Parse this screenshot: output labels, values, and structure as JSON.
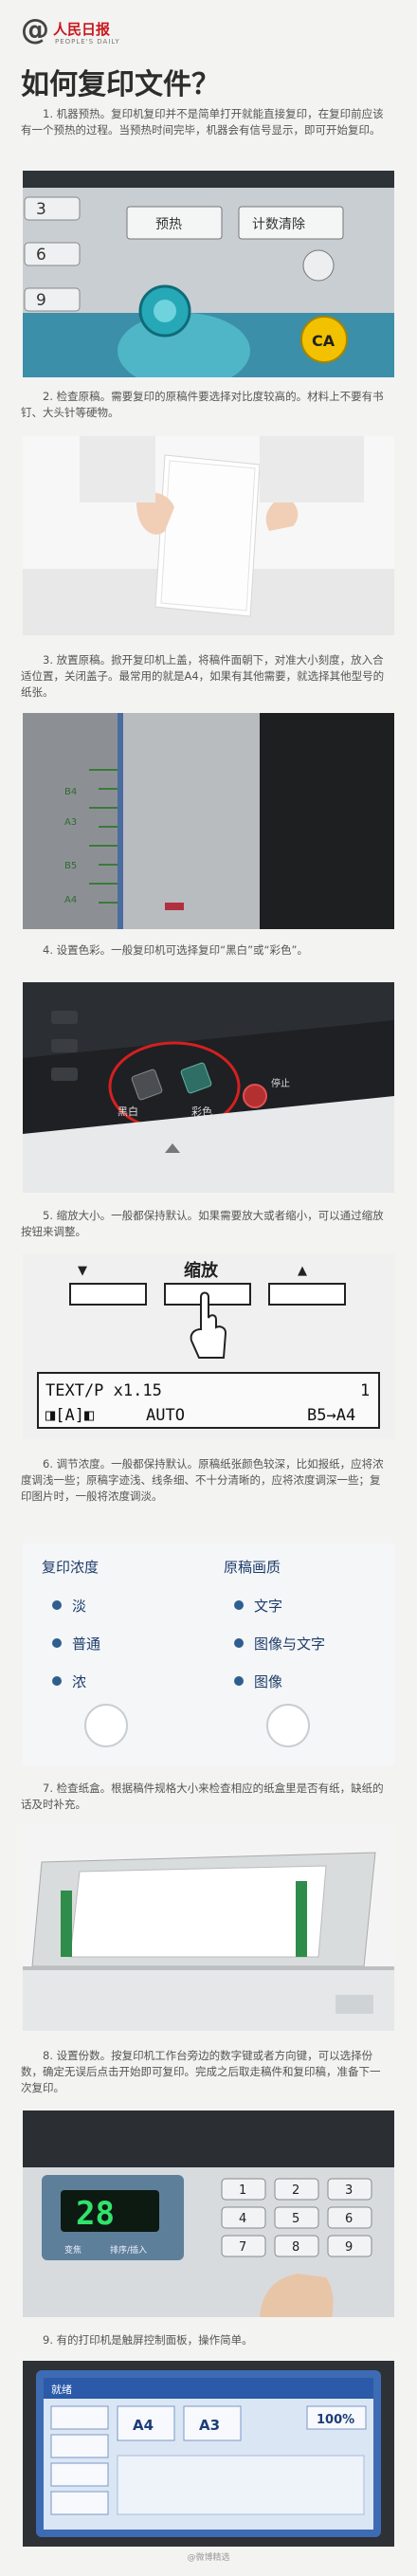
{
  "brand": {
    "at_symbol": "@",
    "name_cn": "人民日报",
    "name_en": "PEOPLE'S DAILY"
  },
  "title": "如何复印文件？",
  "steps": [
    {
      "text": "1. 机器预热。复印机复印并不是简单打开就能直接复印，在复印前应该有一个预热的过程。当预热时间完毕，机器会有信号显示，即可开始复印。"
    },
    {
      "text": "2. 检查原稿。需要复印的原稿件要选择对比度较高的。材料上不要有书钉、大头针等硬物。"
    },
    {
      "text": "3. 放置原稿。掀开复印机上盖，将稿件面朝下，对准大小刻度，放入合适位置，关闭盖子。最常用的就是A4，如果有其他需要，就选择其他型号的纸张。"
    },
    {
      "text": "4. 设置色彩。一般复印机可选择复印“黑白”或“彩色”。"
    },
    {
      "text": "5. 缩放大小。一般都保持默认。如果需要放大或者缩小，可以通过缩放按钮来调整。"
    },
    {
      "text": "6. 调节浓度。一般都保持默认。原稿纸张颜色较深，比如报纸，应将浓度调浅一些；原稿字迹浅、线条细、不十分清晰的，应将浓度调深一些；复印图片时，一般将浓度调淡。"
    },
    {
      "text": "7. 检查纸盒。根据稿件规格大小来检查相应的纸盒里是否有纸，缺纸的话及时补充。"
    },
    {
      "text": "8. 设置份数。按复印机工作台旁边的数字键或者方向键，可以选择份数，确定无误后点击开始即可复印。完成之后取走稿件和复印稿，准备下一次复印。"
    },
    {
      "text": "9. 有的打印机是触屏控制面板，操作简单。"
    }
  ],
  "photo1": {
    "keys": [
      "3",
      "6",
      "9"
    ],
    "btn_preheat": "预热",
    "btn_clear": "计数清除",
    "btn_ca": "CA"
  },
  "photo3": {
    "scale_labels": [
      "B4",
      "A3",
      "B5",
      "A4"
    ]
  },
  "photo4": {
    "label_bw": "黑白",
    "label_color": "彩色",
    "label_stop": "停止"
  },
  "photo5": {
    "button_label": "缩放",
    "arrow_down": "▼",
    "arrow_up": "▲",
    "lcd_line1_left": "TEXT/P x1.15",
    "lcd_line1_right": "1",
    "lcd_line2_left": "◨[A]◧",
    "lcd_line2_mid": "AUTO",
    "lcd_line2_right": "B5→A4"
  },
  "photo6": {
    "col1_title": "复印浓度",
    "col1_items": [
      "淡",
      "普通",
      "浓"
    ],
    "col2_title": "原稿画质",
    "col2_items": [
      "文字",
      "图像与文字",
      "图像"
    ],
    "dot_color": "#2f5e8e"
  },
  "photo8": {
    "display": "28",
    "keypad": [
      "1",
      "2",
      "3",
      "4",
      "5",
      "6",
      "7",
      "8",
      "9"
    ],
    "label_color": "变焦",
    "label_sort": "排序/插入"
  },
  "photo9": {
    "top_label": "就绪",
    "paper_a": "A4",
    "paper_b": "A3",
    "zoom": "100%"
  },
  "watermark": "@微博精选"
}
